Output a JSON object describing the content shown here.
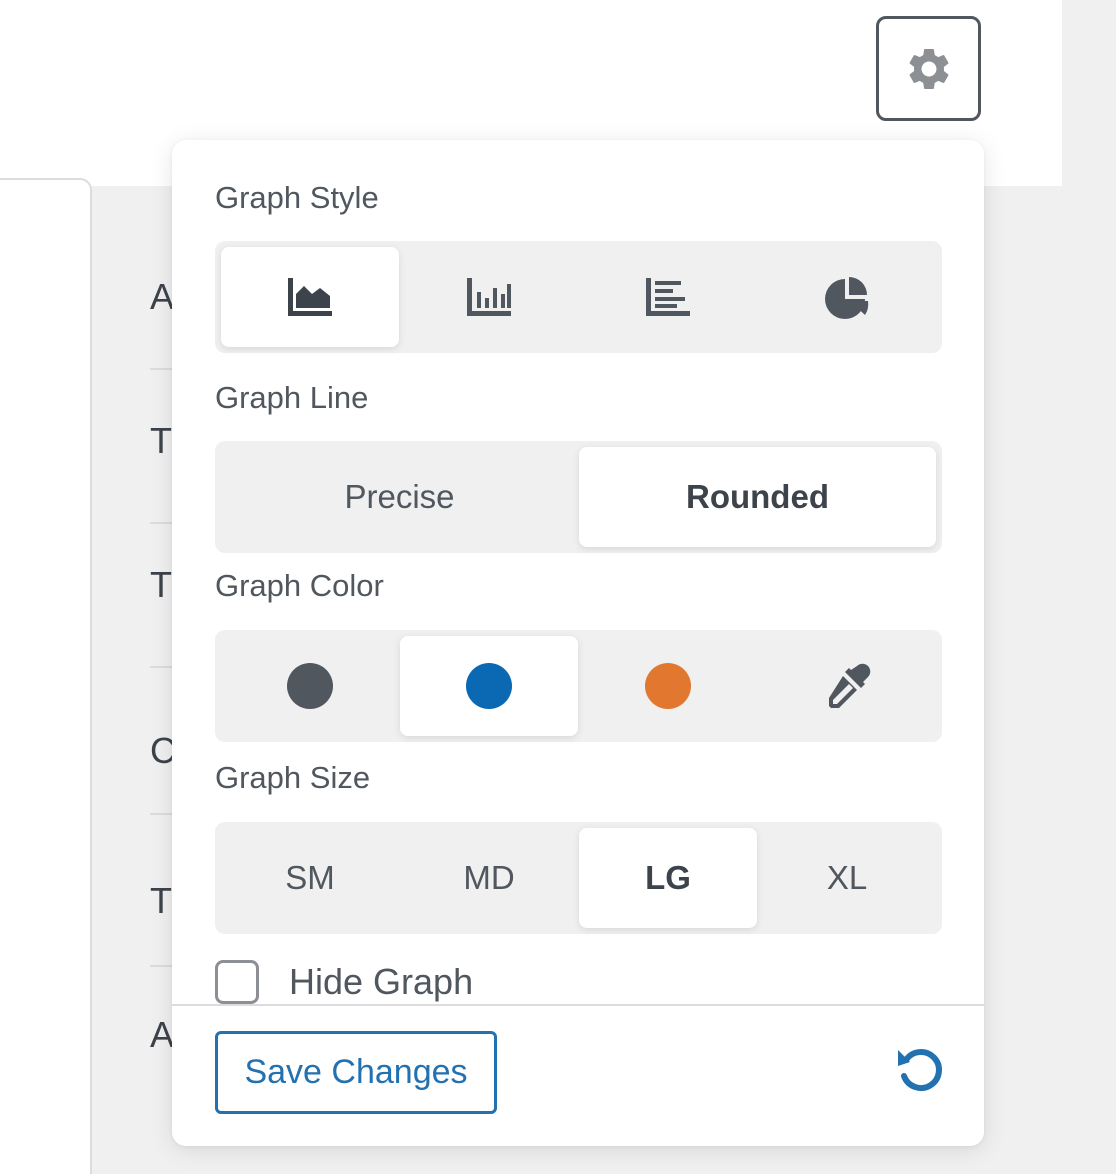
{
  "background": {
    "letters": [
      "A",
      "T",
      "T",
      "C",
      "T",
      "A"
    ]
  },
  "settings_button": {
    "icon": "gear-icon"
  },
  "panel": {
    "graph_style": {
      "label": "Graph Style",
      "options": [
        {
          "icon": "area-chart-icon",
          "active": true
        },
        {
          "icon": "bar-chart-icon",
          "active": false
        },
        {
          "icon": "horizontal-bar-chart-icon",
          "active": false
        },
        {
          "icon": "pie-chart-icon",
          "active": false
        }
      ]
    },
    "graph_line": {
      "label": "Graph Line",
      "options": [
        {
          "label": "Precise",
          "active": false
        },
        {
          "label": "Rounded",
          "active": true
        }
      ]
    },
    "graph_color": {
      "label": "Graph Color",
      "options": [
        {
          "color": "#50575e",
          "active": false
        },
        {
          "color": "#0b68b3",
          "active": true
        },
        {
          "color": "#e27730",
          "active": false
        },
        {
          "icon": "eyedropper-icon",
          "active": false
        }
      ]
    },
    "graph_size": {
      "label": "Graph Size",
      "options": [
        {
          "label": "SM",
          "active": false
        },
        {
          "label": "MD",
          "active": false
        },
        {
          "label": "LG",
          "active": true
        },
        {
          "label": "XL",
          "active": false
        }
      ]
    },
    "hide_graph": {
      "label": "Hide Graph",
      "checked": false
    },
    "save_label": "Save Changes",
    "reset_icon": "reset-icon"
  },
  "colors": {
    "accent": "#2271b1",
    "text": "#50575e",
    "segment_bg": "#f0f0f1"
  }
}
